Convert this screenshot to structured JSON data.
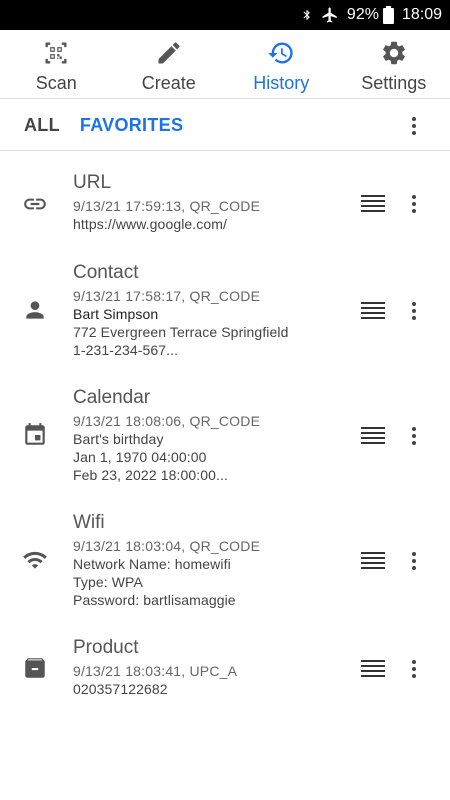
{
  "status_bar": {
    "battery_percent": "92%",
    "time": "18:09"
  },
  "nav": {
    "tabs": [
      {
        "label": "Scan",
        "icon": "qr-scan-icon"
      },
      {
        "label": "Create",
        "icon": "pencil-icon"
      },
      {
        "label": "History",
        "icon": "history-icon",
        "active": true
      },
      {
        "label": "Settings",
        "icon": "gear-icon"
      }
    ]
  },
  "filters": {
    "all": "ALL",
    "favorites": "FAVORITES"
  },
  "history": [
    {
      "type": "URL",
      "icon": "link-icon",
      "meta": "9/13/21 17:59:13, QR_CODE",
      "lines": [
        "https://www.google.com/"
      ]
    },
    {
      "type": "Contact",
      "icon": "person-icon",
      "meta": "9/13/21 17:58:17, QR_CODE",
      "lines": [
        "Bart Simpson",
        "772 Evergreen Terrace Springfield",
        "1-231-234-567..."
      ]
    },
    {
      "type": "Calendar",
      "icon": "calendar-icon",
      "meta": "9/13/21 18:08:06, QR_CODE",
      "lines": [
        "Bart's birthday",
        "Jan 1, 1970 04:00:00",
        "Feb 23, 2022 18:00:00..."
      ]
    },
    {
      "type": "Wifi",
      "icon": "wifi-icon",
      "meta": "9/13/21 18:03:04, QR_CODE",
      "lines": [
        "Network Name: homewifi",
        "Type: WPA",
        "Password: bartlisamaggie"
      ]
    },
    {
      "type": "Product",
      "icon": "archive-box-icon",
      "meta": "9/13/21 18:03:41, UPC_A",
      "lines": [
        "020357122682"
      ]
    }
  ]
}
